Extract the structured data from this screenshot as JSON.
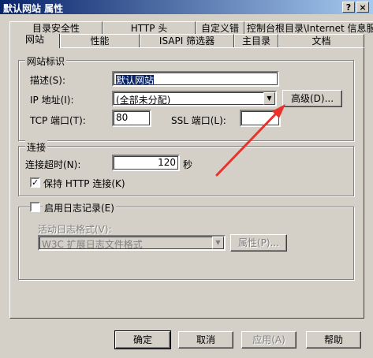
{
  "window": {
    "title": "默认网站 属性",
    "help_glyph": "?",
    "close_glyph": "×"
  },
  "tabs_back": [
    {
      "label": "目录安全性"
    },
    {
      "label": "HTTP 头"
    },
    {
      "label": "自定义错"
    },
    {
      "label": "控制台根目录\\Internet 信息服"
    }
  ],
  "tabs_front": [
    {
      "label": "网站"
    },
    {
      "label": "性能"
    },
    {
      "label": "ISAPI 筛选器"
    },
    {
      "label": "主目录"
    },
    {
      "label": "文档"
    }
  ],
  "website_id": {
    "group_title": "网站标识",
    "description_label": "描述(S):",
    "description_value": "默认网站",
    "ip_label": "IP 地址(I):",
    "ip_value": "(全部未分配)",
    "advanced_button": "高级(D)...",
    "tcp_label": "TCP 端口(T):",
    "tcp_value": "80",
    "ssl_label": "SSL 端口(L):",
    "ssl_value": ""
  },
  "connection": {
    "group_title": "连接",
    "timeout_label": "连接超时(N):",
    "timeout_value": "120",
    "timeout_unit": "秒",
    "keepalive_label": "保持 HTTP 连接(K)",
    "keepalive_checked": true
  },
  "logging": {
    "enable_label": "启用日志记录(E)",
    "enabled": false,
    "format_label": "活动日志格式(V):",
    "format_value": "W3C 扩展日志文件格式",
    "properties_button": "属性(P)..."
  },
  "footer": {
    "ok": "确定",
    "cancel": "取消",
    "apply": "应用(A)",
    "help": "帮助"
  },
  "colors": {
    "annotation_arrow": "#e8322a",
    "titlebar": "#0a246a",
    "dialog_bg": "#d4d0c8"
  },
  "icons": {
    "help": "question-mark-icon",
    "close": "close-icon",
    "dropdown": "chevron-down-icon",
    "check": "checkmark-icon"
  }
}
